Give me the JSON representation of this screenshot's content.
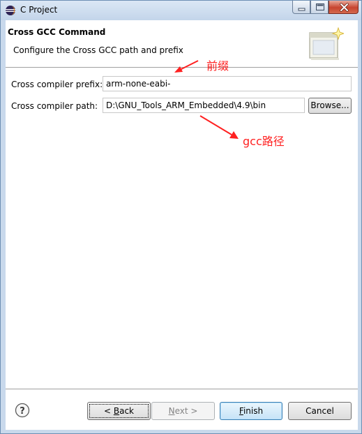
{
  "window": {
    "title": "C Project"
  },
  "banner": {
    "title": "Cross GCC Command",
    "description": "Configure the Cross GCC path and prefix"
  },
  "form": {
    "prefix_label": "Cross compiler prefix:",
    "prefix_value": "arm-none-eabi-",
    "path_label": "Cross compiler path:",
    "path_value": "D:\\GNU_Tools_ARM_Embedded\\4.9\\bin",
    "browse_label": "Browse..."
  },
  "annotations": {
    "prefix_note": "前缀",
    "path_note": "gcc路径",
    "color": "#ff2020"
  },
  "buttons": {
    "back_prefix": "< ",
    "back_mnemonic": "B",
    "back_rest": "ack",
    "next_mnemonic": "N",
    "next_rest": "ext >",
    "finish_mnemonic": "F",
    "finish_rest": "inish",
    "cancel_label": "Cancel"
  },
  "icons": {
    "app": "eclipse-icon",
    "help": "help-icon",
    "banner": "wizard-window-icon"
  }
}
